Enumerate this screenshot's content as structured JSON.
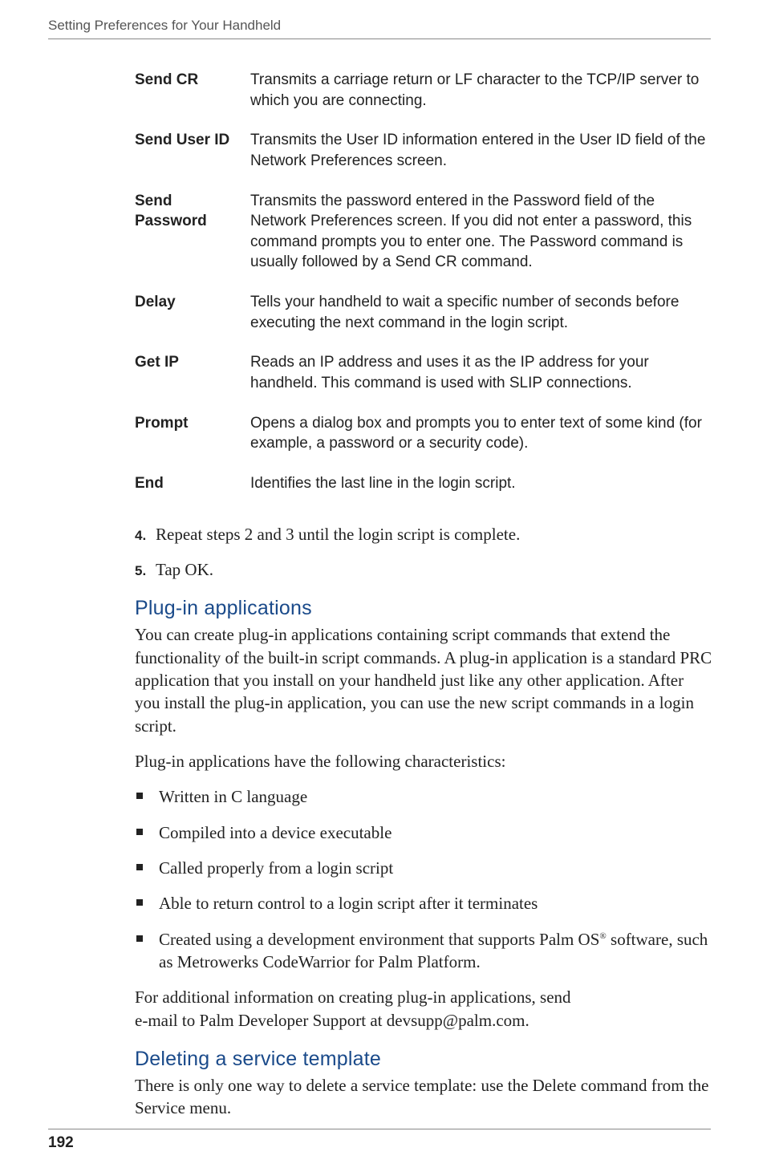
{
  "header": {
    "running_head": "Setting Preferences for Your Handheld"
  },
  "definitions": [
    {
      "term": "Send CR",
      "desc": "Transmits a carriage return or LF character to the TCP/IP server to which you are connecting."
    },
    {
      "term": "Send User ID",
      "desc": "Transmits the User ID information entered in the User ID field of the Network Preferences screen."
    },
    {
      "term": "Send Password",
      "desc": "Transmits the password entered in the Password field of the Network Preferences screen. If you did not enter a password, this command prompts you to enter one. The Password command is usually followed by a Send CR command."
    },
    {
      "term": "Delay",
      "desc": "Tells your handheld to wait a specific number of seconds before executing the next command in the login script."
    },
    {
      "term": "Get IP",
      "desc": "Reads an IP address and uses it as the IP address for your handheld. This command is used with SLIP connections."
    },
    {
      "term": "Prompt",
      "desc": "Opens a dialog box and prompts you to enter text of some kind (for example, a password or a security code)."
    },
    {
      "term": "End",
      "desc": "Identifies the last line in the login script."
    }
  ],
  "steps": [
    {
      "num": "4.",
      "text": "Repeat steps 2 and 3 until the login script is complete."
    },
    {
      "num": "5.",
      "text": "Tap OK."
    }
  ],
  "sections": {
    "plugin": {
      "heading": "Plug-in applications",
      "para1": "You can create plug-in applications containing script commands that extend the functionality of the built-in script commands. A plug-in application is a standard PRC application that you install on your handheld just like any other application. After you install the plug-in application, you can use the new script commands in a login script.",
      "para2": "Plug-in applications have the following characteristics:",
      "bullets": [
        "Written in C language",
        "Compiled into a device executable",
        "Called properly from a login script",
        "Able to return control to a login script after it terminates"
      ],
      "bullet5_pre": "Created using a development environment that supports Palm OS",
      "bullet5_post": " software, such as Metrowerks CodeWarrior for Palm Platform.",
      "para3a": "For additional information on creating plug-in applications, send",
      "para3b": "e-mail to Palm Developer Support at devsupp@palm.com."
    },
    "deleting": {
      "heading": "Deleting a service template",
      "para1": "There is only one way to delete a service template: use the Delete command from the Service menu."
    }
  },
  "footer": {
    "page_number": "192"
  }
}
